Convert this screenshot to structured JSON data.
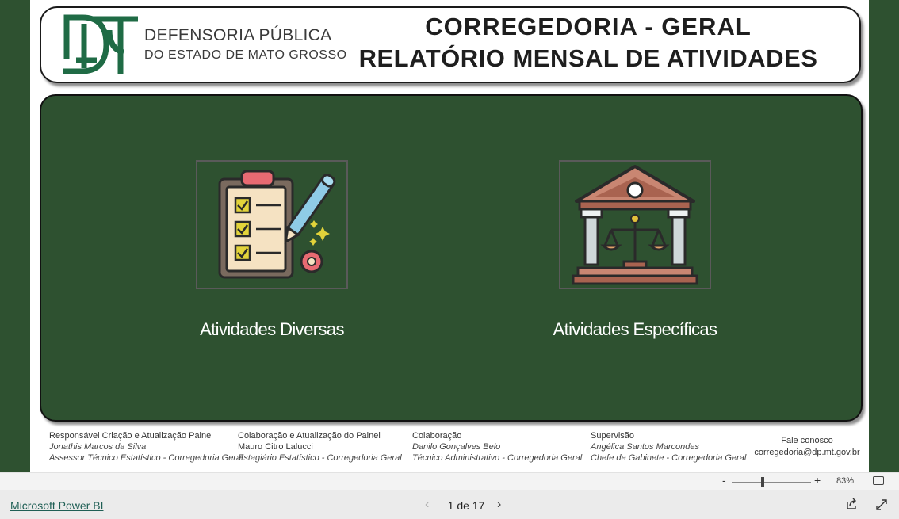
{
  "header": {
    "org_line1": "DEFENSORIA PÚBLICA",
    "org_line2": "DO ESTADO DE MATO GROSSO",
    "title_line1": "CORREGEDORIA - GERAL",
    "title_line2": "RELATÓRIO MENSAL DE ATIVIDADES"
  },
  "nav": {
    "tiles": [
      {
        "label": "Atividades Diversas",
        "icon": "checklist-clipboard-icon"
      },
      {
        "label": "Atividades Específicas",
        "icon": "courthouse-scales-icon"
      }
    ]
  },
  "footer": {
    "credits": [
      {
        "title": "Responsável Criação e Atualização Painel",
        "name": "Jonathis Marcos da Silva",
        "role": "Assessor Técnico Estatístico - Corregedoria Geral"
      },
      {
        "title": "Colaboração e Atualização do Painel",
        "name": "Mauro Citro Lalucci",
        "role": "Estagiário Estatístico - Corregedoria Geral"
      },
      {
        "title": "Colaboração",
        "name": "Danilo Gonçalves Belo",
        "role": "Técnico Administrativo - Corregedoria Geral"
      },
      {
        "title": "Supervisão",
        "name": "Angélica Santos Marcondes",
        "role": "Chefe de Gabinete - Corregedoria Geral"
      }
    ],
    "contact_title": "Fale conosco",
    "contact_email": "corregedoria@dp.mt.gov.br"
  },
  "status": {
    "zoom_minus": "-",
    "zoom_plus": "+",
    "zoom_level": "83%"
  },
  "bottom": {
    "app_link": "Microsoft Power BI",
    "page_indicator": "1 de 17",
    "prev_glyph": "‹",
    "next_glyph": "›"
  },
  "colors": {
    "brand_green": "#2e5130",
    "logo_green": "#1f6b45",
    "link_teal": "#1f5f55"
  }
}
